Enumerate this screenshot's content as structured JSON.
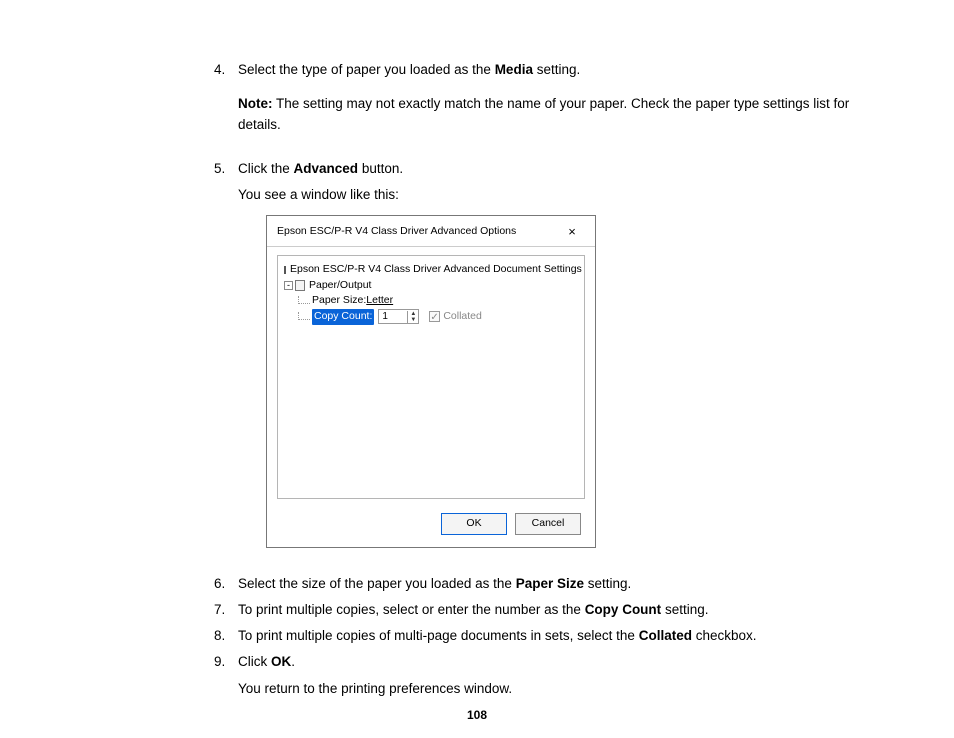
{
  "steps": {
    "s4": {
      "num": "4.",
      "line1a": "Select the type of paper you loaded as the ",
      "line1bold": "Media",
      "line1b": " setting."
    },
    "s4note": {
      "bold": "Note:",
      "text": " The setting may not exactly match the name of your paper. Check the paper type settings list for details."
    },
    "s5": {
      "num": "5.",
      "line1a": "Click the ",
      "line1bold": "Advanced",
      "line1b": " button.",
      "line2": "You see a window like this:"
    },
    "s6": {
      "num": "6.",
      "line1a": "Select the size of the paper you loaded as the ",
      "line1bold": "Paper Size",
      "line1b": " setting."
    },
    "s7": {
      "num": "7.",
      "line1a": "To print multiple copies, select or enter the number as the ",
      "line1bold": "Copy Count",
      "line1b": " setting."
    },
    "s8": {
      "num": "8.",
      "line1a": "To print multiple copies of multi-page documents in sets, select the ",
      "line1bold": "Collated",
      "line1b": " checkbox."
    },
    "s9": {
      "num": "9.",
      "line1a": "Click ",
      "line1bold": "OK",
      "line1b": ".",
      "line2": "You return to the printing preferences window."
    }
  },
  "dialog": {
    "title": "Epson ESC/P-R V4 Class Driver Advanced Options",
    "tree": {
      "root": "Epson ESC/P-R V4 Class Driver Advanced Document Settings",
      "paper_output": "Paper/Output",
      "paper_size_label": "Paper Size: ",
      "paper_size_value": "Letter",
      "copy_count_label": "Copy Count:",
      "copy_count_value": "1",
      "collated_label": "Collated"
    },
    "ok": "OK",
    "cancel": "Cancel"
  },
  "page_number": "108"
}
